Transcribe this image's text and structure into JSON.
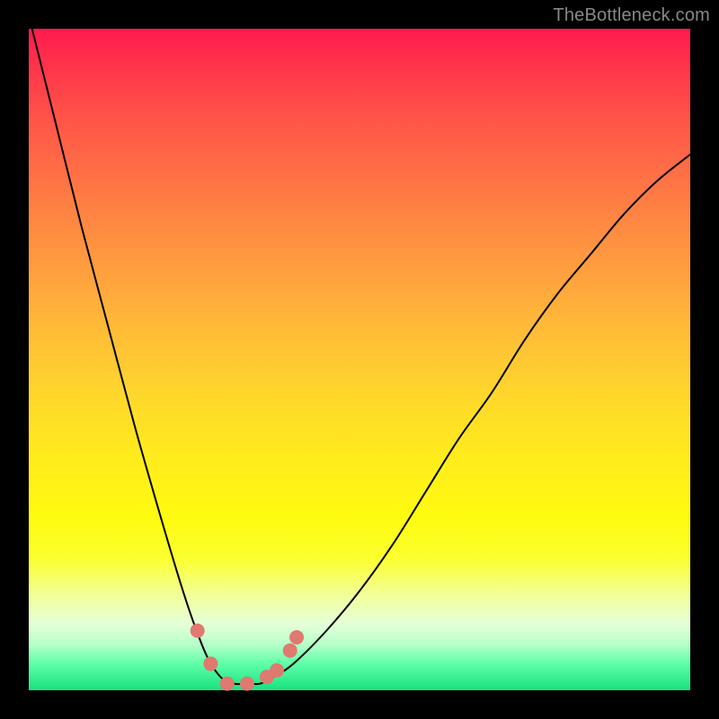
{
  "watermark": "TheBottleneck.com",
  "colors": {
    "gradient_top": "#ff1a4d",
    "gradient_bottom": "#18e27e",
    "curve": "#000000",
    "marker": "#e0796f",
    "frame": "#000000"
  },
  "chart_data": {
    "type": "line",
    "title": "",
    "xlabel": "",
    "ylabel": "",
    "xlim": [
      0,
      100
    ],
    "ylim": [
      0,
      100
    ],
    "series": [
      {
        "name": "bottleneck-curve",
        "x": [
          0,
          4,
          8,
          12,
          16,
          20,
          23,
          25,
          27,
          29,
          31,
          33,
          35,
          37,
          40,
          45,
          50,
          55,
          60,
          65,
          70,
          75,
          80,
          85,
          90,
          95,
          100
        ],
        "y": [
          102,
          86,
          70,
          55,
          40,
          26,
          16,
          10,
          5,
          2,
          1,
          1,
          1,
          2,
          4,
          9,
          15,
          22,
          30,
          38,
          45,
          53,
          60,
          66,
          72,
          77,
          81
        ]
      }
    ],
    "markers": [
      {
        "x": 25.5,
        "y": 9
      },
      {
        "x": 27.5,
        "y": 4
      },
      {
        "x": 30,
        "y": 1
      },
      {
        "x": 33,
        "y": 1
      },
      {
        "x": 36,
        "y": 2
      },
      {
        "x": 37.5,
        "y": 3
      },
      {
        "x": 39.5,
        "y": 6
      },
      {
        "x": 40.5,
        "y": 8
      }
    ]
  }
}
